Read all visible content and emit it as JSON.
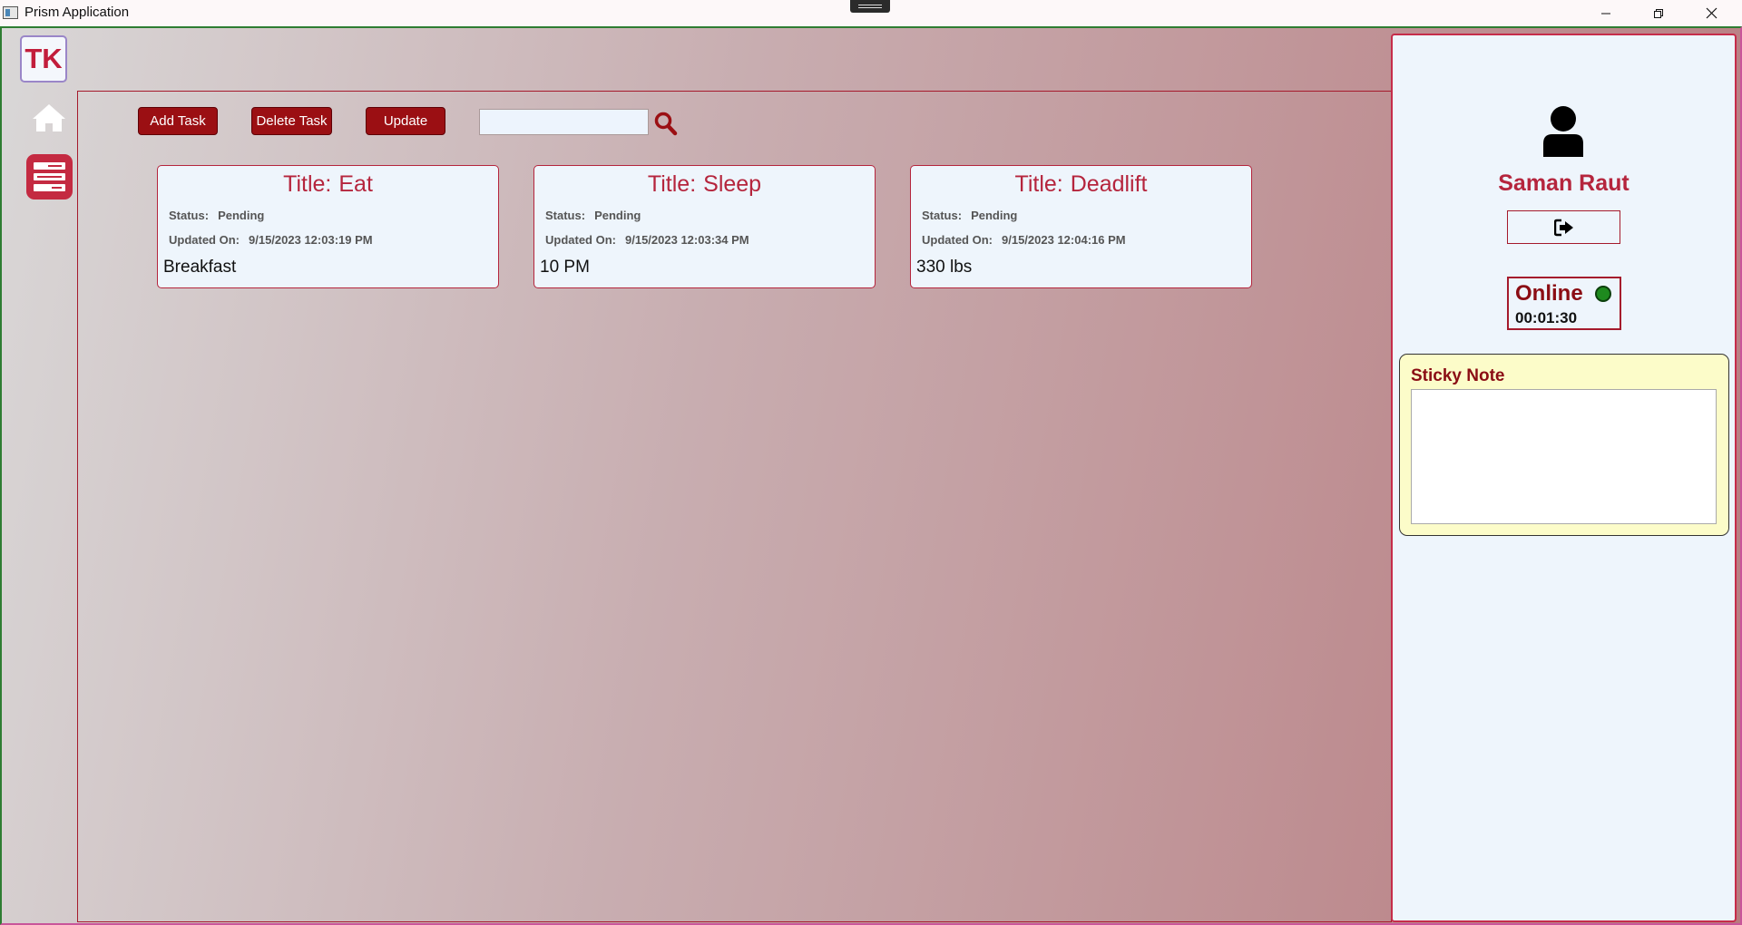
{
  "window": {
    "title": "Prism Application",
    "controls": [
      "minimize",
      "maximize",
      "close"
    ]
  },
  "sidebar": {
    "logo_text": "TK",
    "nav": [
      {
        "name": "home",
        "icon": "home-icon"
      },
      {
        "name": "tasks",
        "icon": "task-list-icon",
        "active": true
      }
    ]
  },
  "toolbar": {
    "add_label": "Add Task",
    "delete_label": "Delete Task",
    "update_label": "Update",
    "search_value": "",
    "search_icon": "search-icon"
  },
  "tasks": [
    {
      "title_label": "Title:",
      "title": "Eat",
      "status_label": "Status:",
      "status": "Pending",
      "updated_label": "Updated On:",
      "updated": "9/15/2023 12:03:19 PM",
      "description": "Breakfast"
    },
    {
      "title_label": "Title:",
      "title": "Sleep",
      "status_label": "Status:",
      "status": "Pending",
      "updated_label": "Updated On:",
      "updated": "9/15/2023 12:03:34 PM",
      "description": "10 PM"
    },
    {
      "title_label": "Title:",
      "title": "Deadlift",
      "status_label": "Status:",
      "status": "Pending",
      "updated_label": "Updated On:",
      "updated": "9/15/2023 12:04:16 PM",
      "description": "330 lbs"
    }
  ],
  "profile": {
    "user_icon": "user-icon",
    "name": "Saman Raut",
    "logout_icon": "sign-out-icon",
    "status": "Online",
    "status_color": "#1e8a1e",
    "timer": "00:01:30"
  },
  "sticky_note": {
    "title": "Sticky Note",
    "content": ""
  },
  "colors": {
    "accent": "#b5253d",
    "button": "#9b0f13",
    "panel_bg": "#eef5fc",
    "note_bg": "#fcfcc9"
  }
}
